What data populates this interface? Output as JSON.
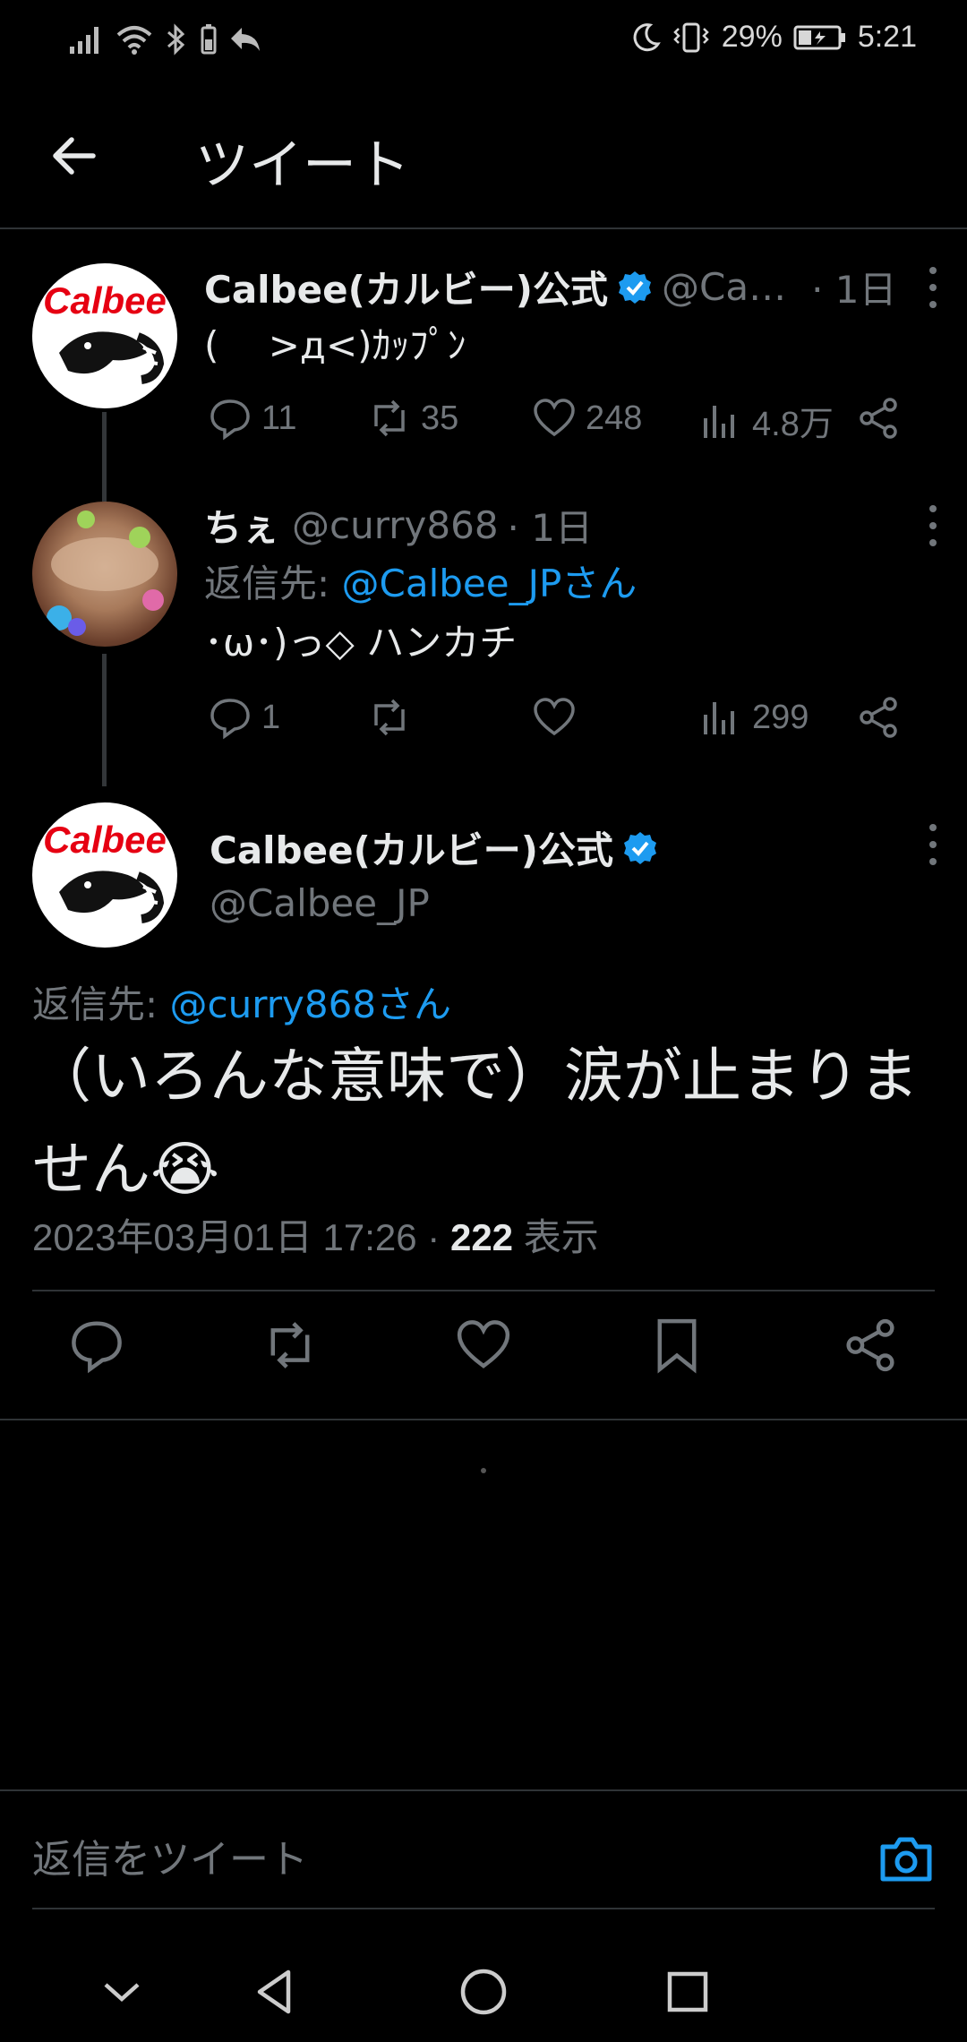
{
  "status_bar": {
    "battery": "29%",
    "time": "5:21",
    "icons": [
      "signal-icon",
      "wifi-icon",
      "bluetooth-icon",
      "battery-small-icon",
      "share-back-icon",
      "moon-icon",
      "vibrate-icon",
      "battery-icon"
    ]
  },
  "header": {
    "title": "ツイート"
  },
  "tweet1": {
    "name": "Calbee(カルビー)公式",
    "handle": "@Ca…",
    "time": "· 1日",
    "text": "(　 >д<)ｶｯﾌﾟﾝ",
    "avatar_text": "Calbee",
    "replies": "11",
    "retweets": "35",
    "likes": "248",
    "views": "4.8万"
  },
  "tweet2": {
    "name": "ちぇ",
    "handle": "@curry868",
    "time": "· 1日",
    "reply_prefix": "返信先: ",
    "reply_to": "@Calbee_JPさん",
    "text": "･ω･)っ◇ ハンカチ",
    "replies": "1",
    "views": "299"
  },
  "main_tweet": {
    "name": "Calbee(カルビー)公式",
    "handle": "@Calbee_JP",
    "reply_prefix": "返信先: ",
    "reply_to": "@curry868さん",
    "text": "（いろんな意味で）涙が止まりません😭",
    "date": "2023年03月01日 17:26 · ",
    "view_count": "222",
    "view_label": " 表示"
  },
  "reply_input": {
    "placeholder": "返信をツイート"
  },
  "colors": {
    "accent": "#1d9bf0",
    "muted": "#71767b",
    "text": "#e7e9ea",
    "background": "#000000",
    "calbee_red": "#e60012"
  }
}
